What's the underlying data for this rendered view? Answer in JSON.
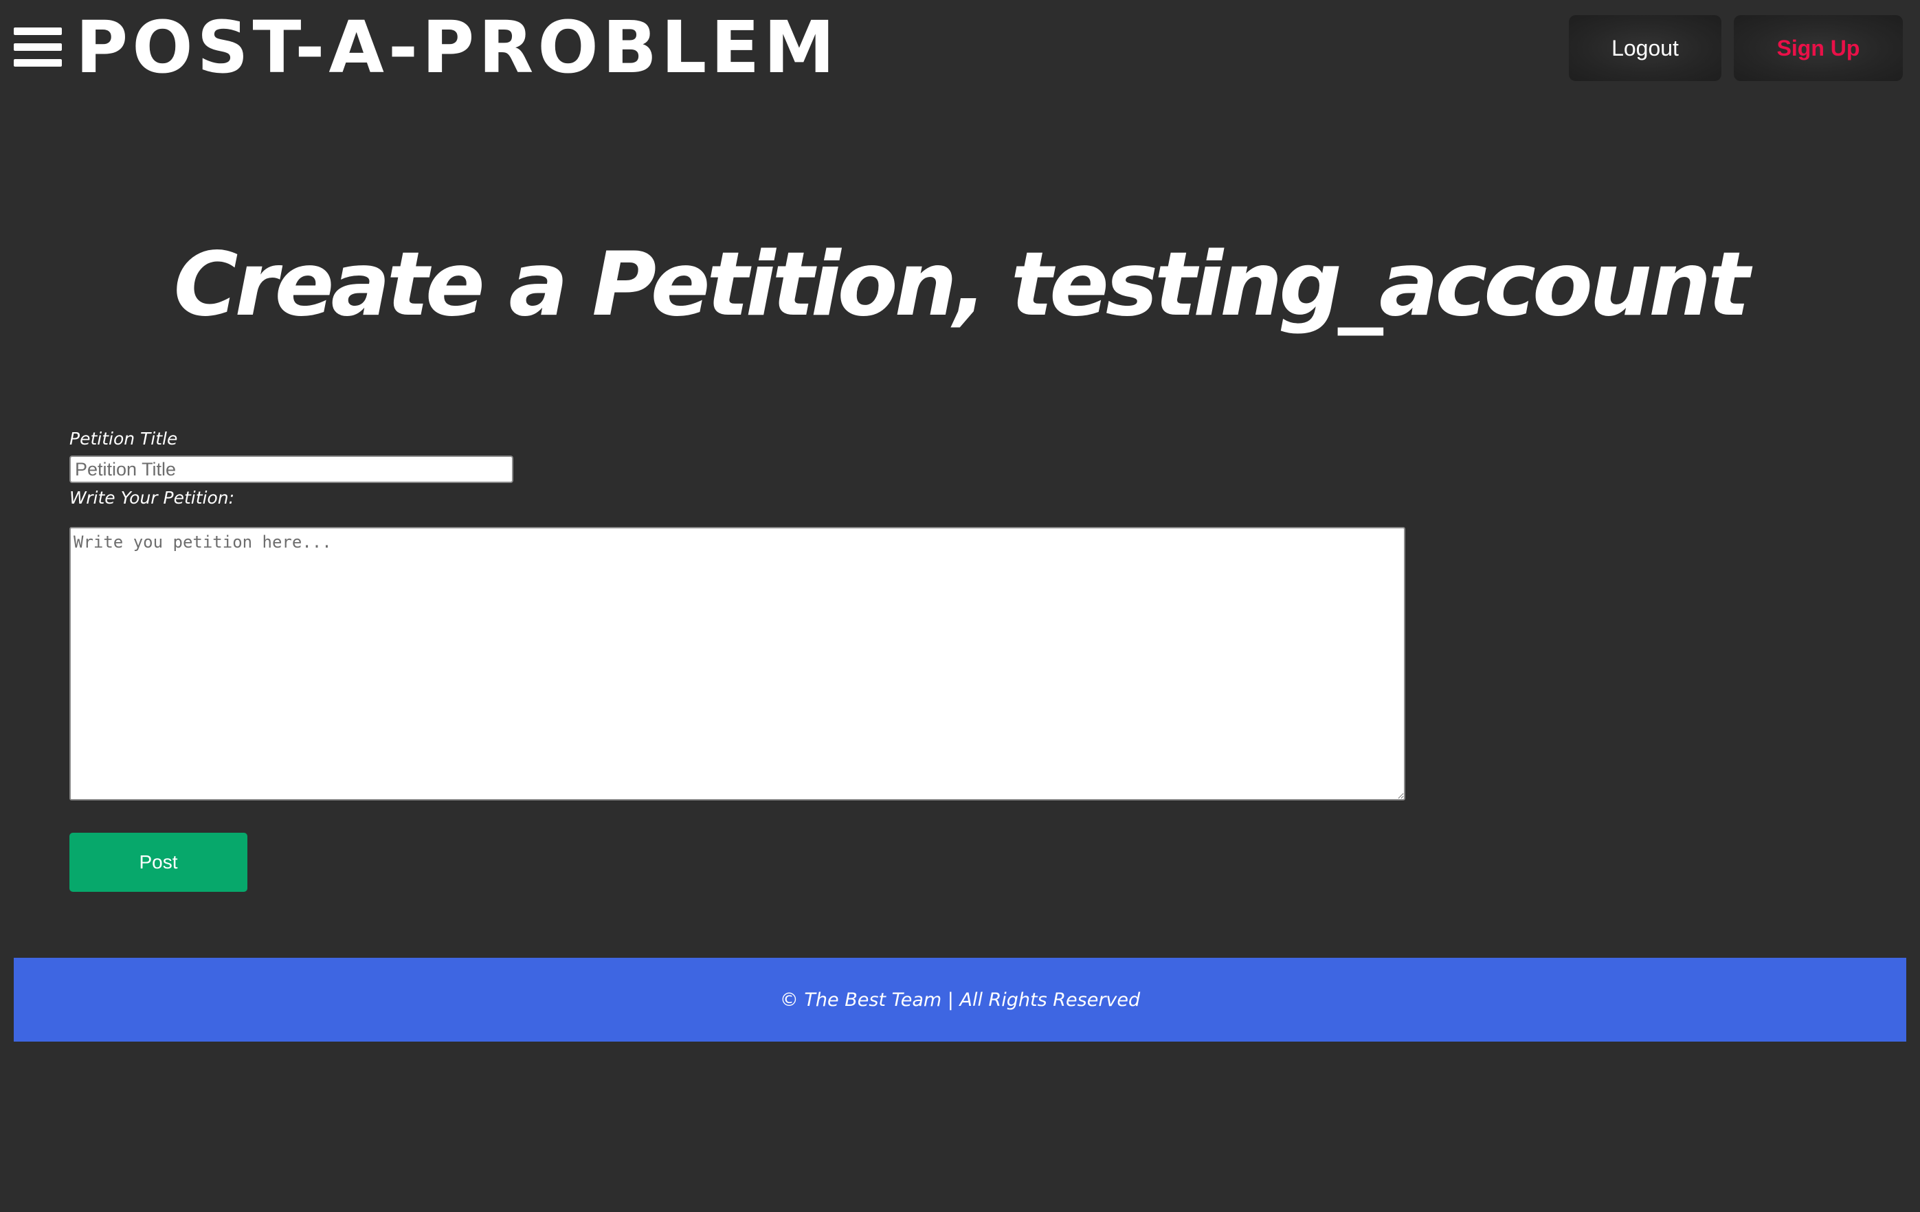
{
  "header": {
    "menu_icon": "hamburger-icon",
    "brand": "POST-A-PROBLEM",
    "logout_label": "Logout",
    "signup_label": "Sign Up"
  },
  "main": {
    "title": "Create a Petition, testing_account",
    "form": {
      "title_label": "Petition Title",
      "title_value": "",
      "title_placeholder": "Petition Title",
      "body_label": "Write Your Petition:",
      "body_value": "",
      "body_placeholder": "Write you petition here...",
      "post_label": "Post"
    }
  },
  "footer": {
    "text": "© The Best Team | All Rights Reserved"
  },
  "colors": {
    "background": "#2d2d2d",
    "signup": "#ea1048",
    "post_button": "#07a86b",
    "footer": "#3e66e2"
  }
}
